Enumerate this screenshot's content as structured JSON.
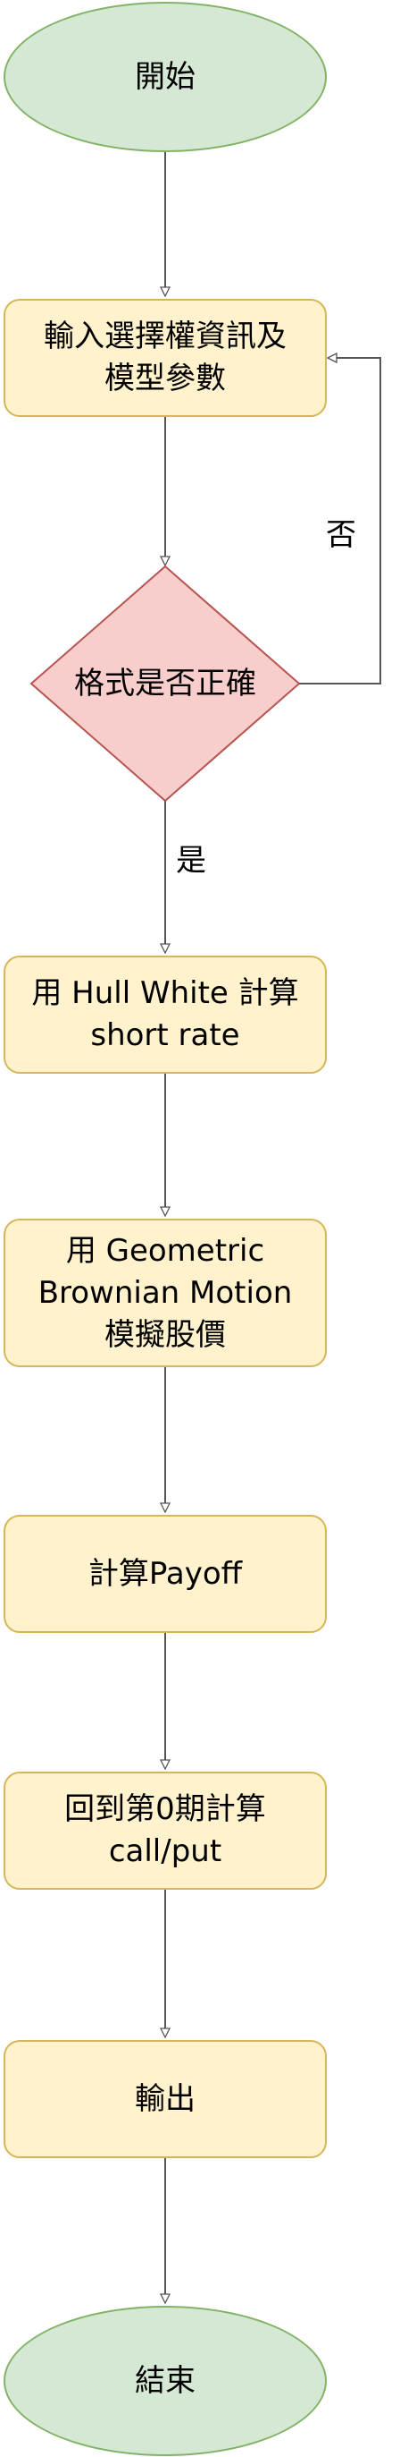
{
  "nodes": {
    "start": "開始",
    "input": "輸入選擇權資訊及\n模型參數",
    "check": "格式是否正確",
    "hull_white": "用 Hull White 計算\nshort rate",
    "gbm": "用 Geometric\nBrownian Motion\n模擬股價",
    "payoff": "計算Payoff",
    "discount": "回到第0期計算\ncall/put",
    "output": "輸出",
    "end": "結束"
  },
  "edge_labels": {
    "no": "否",
    "yes": "是"
  },
  "colors": {
    "terminal_fill": "#d5e8d4",
    "terminal_stroke": "#82b366",
    "process_fill": "#fff2cc",
    "process_stroke": "#d6b656",
    "decision_fill": "#f8cecc",
    "decision_stroke": "#b85450",
    "edge": "#555555"
  }
}
